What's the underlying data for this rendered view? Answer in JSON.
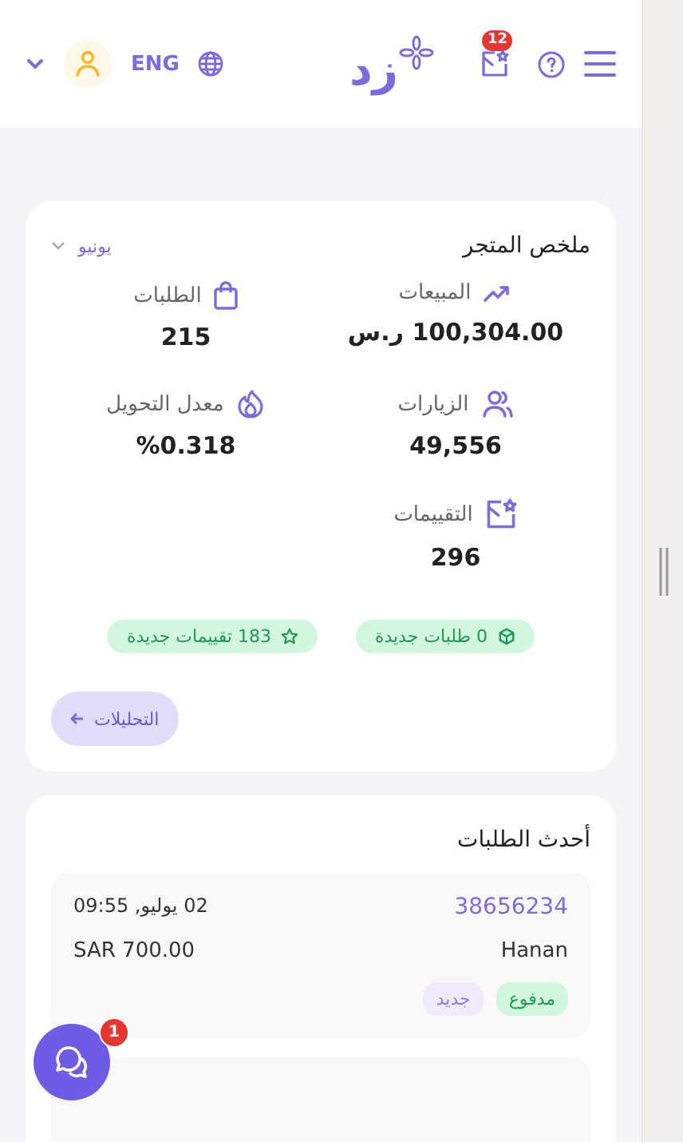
{
  "header": {
    "logo": "زد",
    "language": "ENG",
    "notifications_count": "12"
  },
  "summary": {
    "title": "ملخص المتجر",
    "period": "يونيو",
    "stats": [
      {
        "label": "المبيعات",
        "value": "100,304.00 ر.س"
      },
      {
        "label": "الطلبات",
        "value": "215"
      },
      {
        "label": "الزيارات",
        "value": "49,556"
      },
      {
        "label": "معدل التحويل",
        "value": "%0.318"
      },
      {
        "label": "التقييمات",
        "value": "296"
      }
    ],
    "badges": [
      "0 طلبات جديدة",
      "183 تقييمات جديدة"
    ],
    "analytics_button": "التحليلات"
  },
  "latest_orders": {
    "title": "أحدث الطلبات",
    "orders": [
      {
        "number": "38656234",
        "date": "02 يوليو, 09:55",
        "customer": "Hanan",
        "amount": "SAR 700.00",
        "tags": [
          {
            "kind": "paid",
            "label": "مدفوع"
          },
          {
            "kind": "new",
            "label": "جديد"
          }
        ]
      }
    ]
  },
  "chat": {
    "count": "1"
  }
}
